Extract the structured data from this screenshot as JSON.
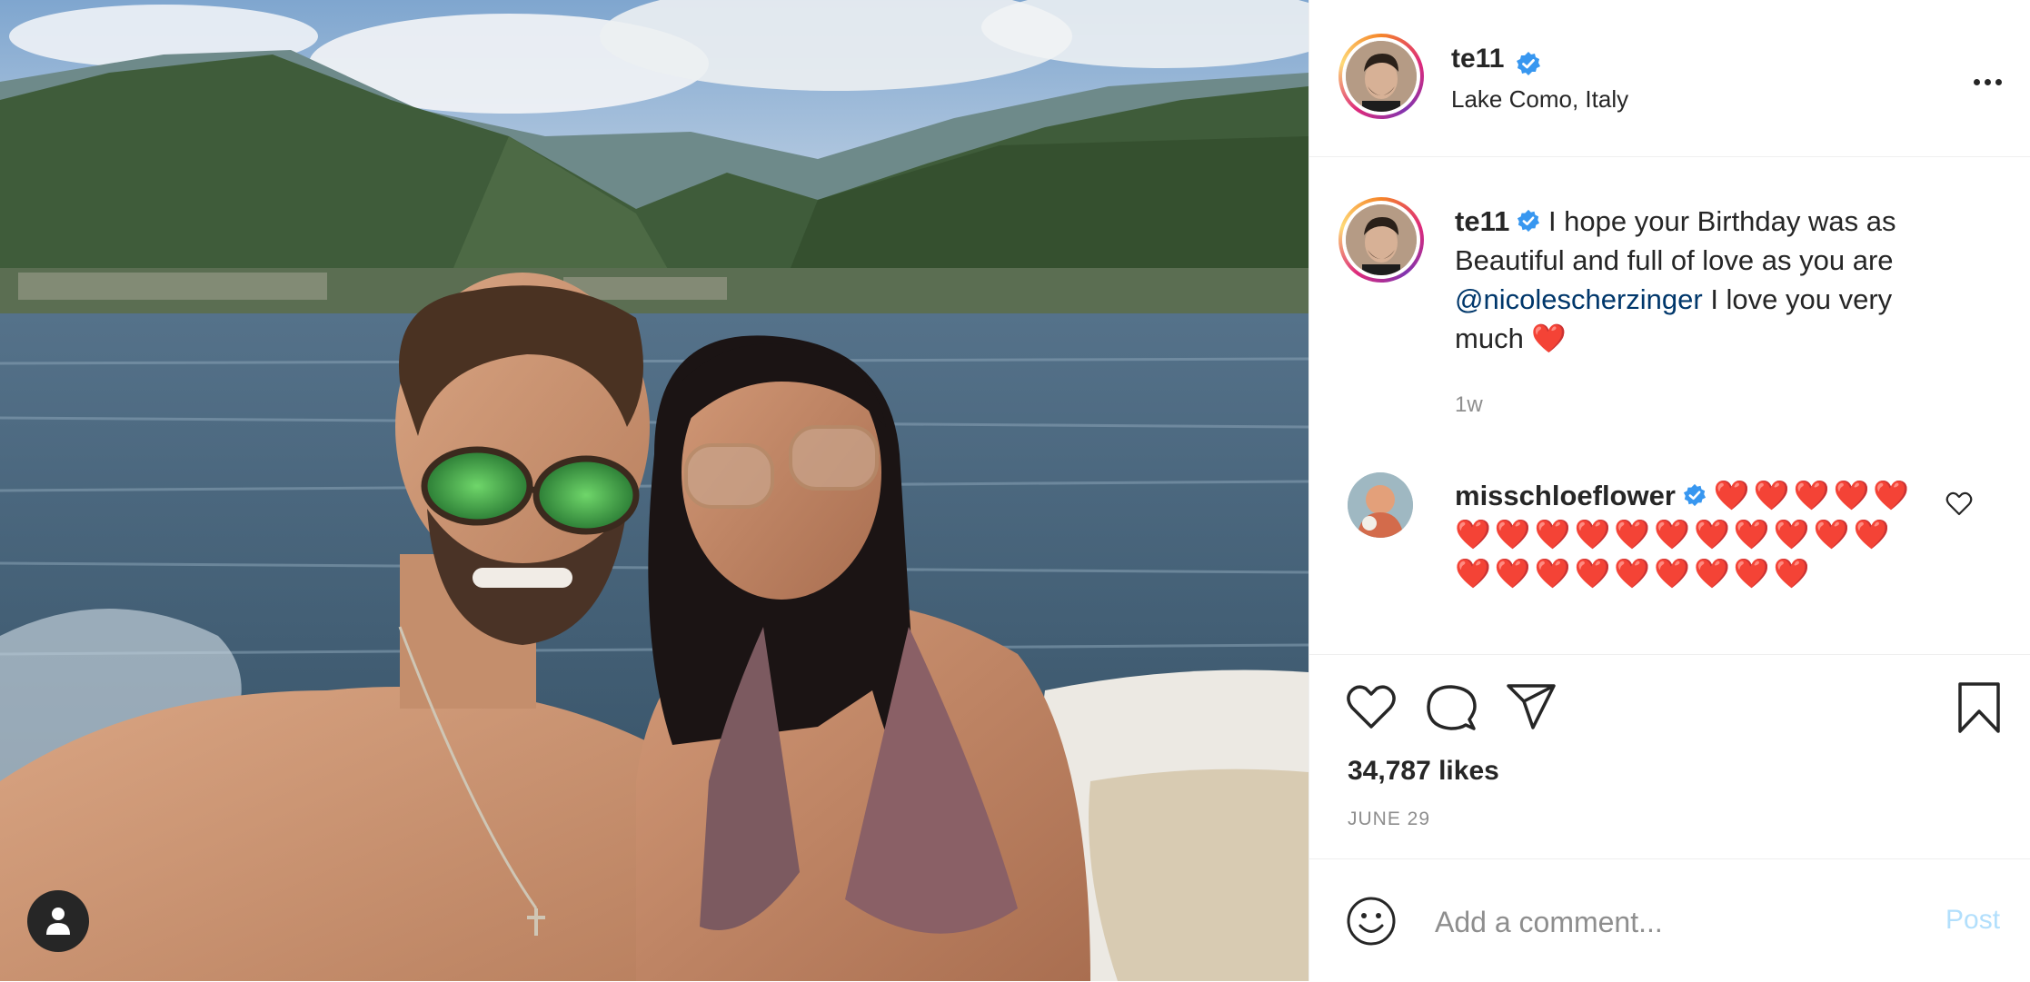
{
  "post": {
    "author": "te11",
    "location": "Lake Como, Italy",
    "caption_text_1": " I hope your Birthday was as Beautiful and full of love as you are ",
    "caption_mention": "@nicolescherzinger",
    "caption_text_2": " I love you very much ",
    "caption_emoji": "❤️",
    "time_ago": "1w",
    "likes": "34,787 likes",
    "date": "JUNE 29"
  },
  "comments": [
    {
      "username": "misschloeflower",
      "hearts": "❤️❤️❤️❤️❤️❤️❤️❤️❤️❤️❤️❤️❤️❤️❤️❤️❤️❤️❤️❤️❤️❤️❤️❤️❤️"
    }
  ],
  "comment_box": {
    "placeholder": "Add a comment...",
    "post_label": "Post"
  },
  "colors": {
    "verified": "#3897f0",
    "heart": "#e0102a",
    "mention": "#00376b",
    "post_button_disabled": "#b2dffc"
  },
  "icons": [
    "user-tag-icon",
    "verified-icon",
    "more-options-icon",
    "like-icon",
    "comment-icon",
    "share-icon",
    "save-icon",
    "emoji-icon",
    "comment-like-icon"
  ]
}
